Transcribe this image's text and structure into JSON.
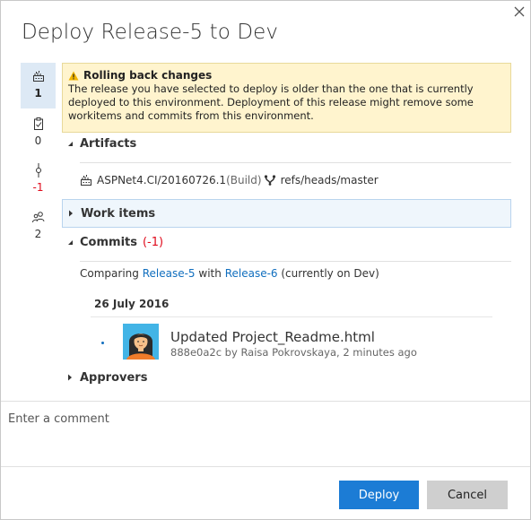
{
  "dialog": {
    "title": "Deploy Release-5 to Dev"
  },
  "rail": [
    {
      "name": "artifacts",
      "icon": "build-icon",
      "count": "1"
    },
    {
      "name": "work-items",
      "icon": "work-item-icon",
      "count": "0"
    },
    {
      "name": "commits",
      "icon": "commit-icon",
      "count": "-1"
    },
    {
      "name": "approvers",
      "icon": "users-icon",
      "count": "2"
    }
  ],
  "warning": {
    "title": "Rolling back changes",
    "text": "The release you have selected to deploy is older than the one that is currently deployed to this environment. Deployment of this release might remove some workitems and commits from this environment."
  },
  "sections": {
    "artifacts": "Artifacts",
    "work_items": "Work items",
    "commits": "Commits",
    "commits_count": "(-1)",
    "approvers": "Approvers"
  },
  "artifact": {
    "name": "ASPNet4.CI/20160726.1",
    "type": "(Build)",
    "branch": "refs/heads/master"
  },
  "compare": {
    "prefix": "Comparing",
    "from": "Release-5",
    "middle": "with",
    "to": "Release-6",
    "suffix": "(currently on Dev)"
  },
  "commit_group": {
    "date": "26 July 2016",
    "commits": [
      {
        "title": "Updated Project_Readme.html",
        "meta": "888e0a2c by Raisa Pokrovskaya, 2 minutes ago"
      }
    ]
  },
  "comment": {
    "placeholder": "Enter a comment"
  },
  "buttons": {
    "deploy": "Deploy",
    "cancel": "Cancel"
  },
  "colors": {
    "primary": "#1c7cd5",
    "link": "#106ebe",
    "warning_bg": "#fff4ce",
    "negative": "#e00b1c"
  }
}
